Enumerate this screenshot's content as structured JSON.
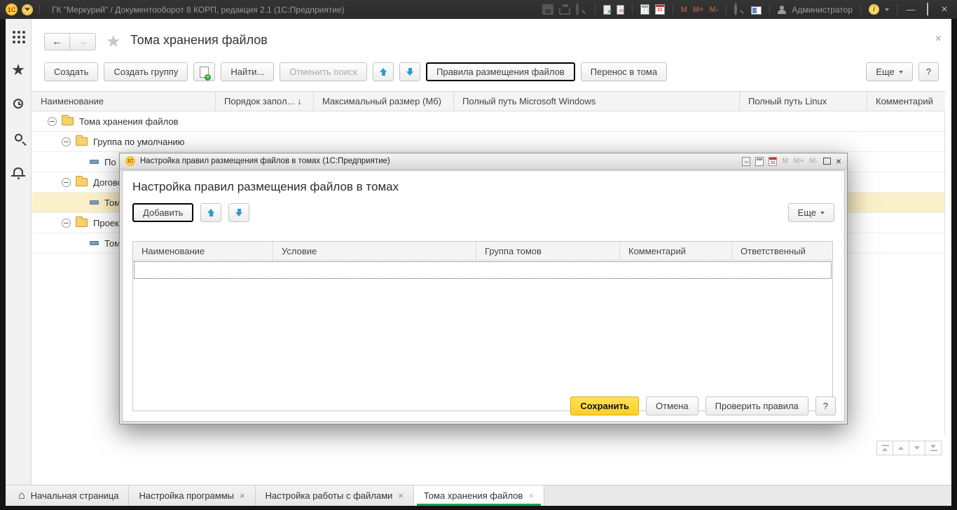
{
  "titlebar": {
    "app_title": "ГК \"Меркурий\" / Документооборот 8 КОРП, редакция 2.1  (1С:Предприятие)",
    "logo_text": "1С",
    "user": "Администратор",
    "m": [
      "M",
      "M+",
      "M-"
    ]
  },
  "page": {
    "title": "Тома хранения файлов",
    "toolbar": {
      "create": "Создать",
      "create_group": "Создать группу",
      "find": "Найти...",
      "cancel_search": "Отменить поиск",
      "placement_rules": "Правила размещения файлов",
      "move_to_volumes": "Перенос в тома",
      "more": "Еще",
      "help": "?"
    },
    "table": {
      "columns": [
        "Наименование",
        "Порядок запол...",
        "Максимальный размер (Мб)",
        "Полный путь Microsoft Windows",
        "Полный путь Linux",
        "Комментарий"
      ],
      "sort_indicator": "↓"
    },
    "tree": [
      {
        "label": "Тома хранения файлов",
        "level": 0,
        "type": "folder"
      },
      {
        "label": "Группа по умолчанию",
        "level": 1,
        "type": "folder"
      },
      {
        "label": "По",
        "level": 2,
        "type": "item"
      },
      {
        "label": "Догово",
        "level": 1,
        "type": "folder"
      },
      {
        "label": "Том",
        "level": 2,
        "type": "item",
        "selected": true
      },
      {
        "label": "Проект",
        "level": 1,
        "type": "folder"
      },
      {
        "label": "Том",
        "level": 2,
        "type": "item"
      }
    ]
  },
  "dialog": {
    "window_title": "Настройка правил размещения файлов в томах  (1С:Предприятие)",
    "logo_text": "1С",
    "heading": "Настройка правил размещения файлов в томах",
    "toolbar": {
      "add": "Добавить",
      "more": "Еще"
    },
    "table": {
      "columns": [
        "Наименование",
        "Условие",
        "Группа томов",
        "Комментарий",
        "Ответственный"
      ]
    },
    "footer": {
      "save": "Сохранить",
      "cancel": "Отмена",
      "check_rules": "Проверить правила",
      "help": "?"
    },
    "m": [
      "M",
      "M+",
      "M-"
    ]
  },
  "tabbar": {
    "tabs": [
      {
        "label": "Начальная страница",
        "closable": false
      },
      {
        "label": "Настройка программы",
        "closable": true
      },
      {
        "label": "Настройка работы с файлами",
        "closable": true
      },
      {
        "label": "Тома хранения файлов",
        "closable": true,
        "active": true
      }
    ],
    "close_glyph": "×"
  },
  "colors": {
    "selection_row": "#fbf0c7",
    "active_tab_underline": "#1da152",
    "save_button": "#fccf28",
    "arrow_blue": "#2f9ad2",
    "folder_yellow": "#f8d06c",
    "titlebar_bg": "#2e2e2e"
  }
}
